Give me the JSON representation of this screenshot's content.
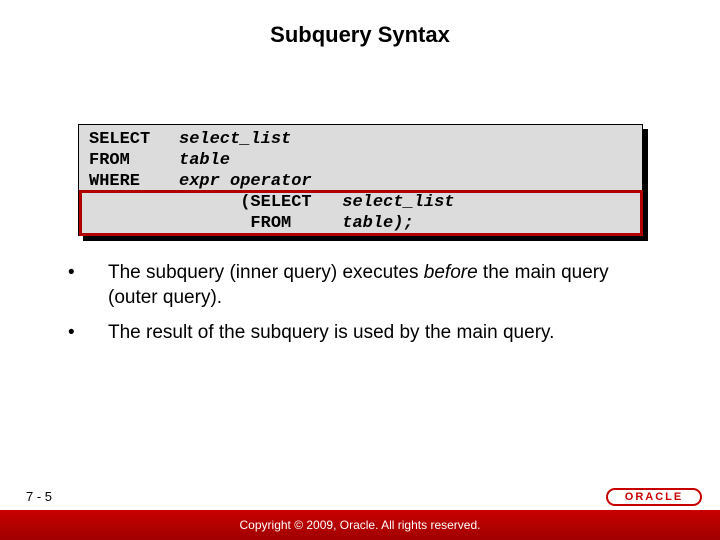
{
  "title": "Subquery Syntax",
  "code": {
    "kw_select": "SELECT",
    "kw_from": "FROM",
    "kw_where": "WHERE",
    "arg_select_list": "select_list",
    "arg_table": "table",
    "arg_expr_op": "expr operator",
    "inner_open": "(SELECT",
    "inner_from": "FROM",
    "inner_select_list": "select_list",
    "inner_table_close": "table);"
  },
  "bullets": [
    {
      "pre": "The subquery (inner query) executes ",
      "em": "before",
      "post": " the main query (outer query)."
    },
    {
      "pre": "The result of the subquery is used by the main query.",
      "em": "",
      "post": ""
    }
  ],
  "footer": {
    "page": "7 - 5",
    "copyright": "Copyright © 2009, Oracle. All rights reserved.",
    "logo_text": "ORACLE"
  }
}
